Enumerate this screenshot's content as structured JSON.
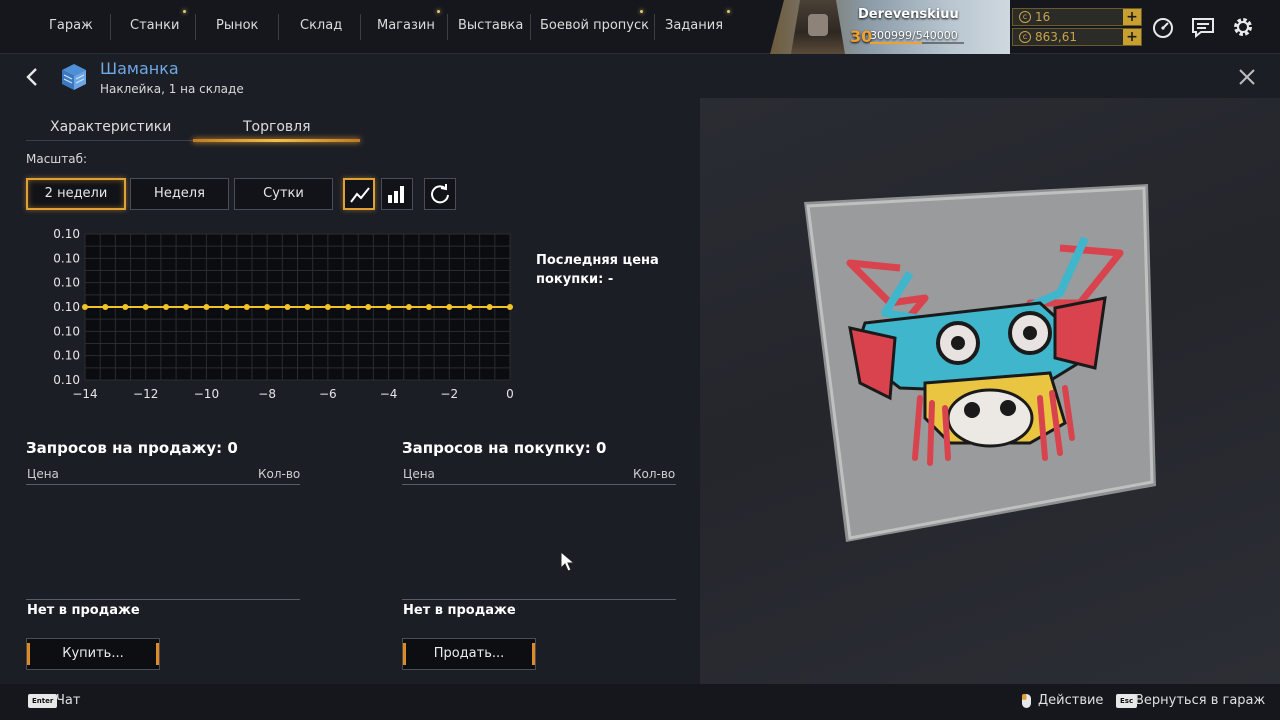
{
  "nav": {
    "items": [
      "Гараж",
      "Станки",
      "Рынок",
      "Склад",
      "Магазин",
      "Выставка",
      "Боевой пропуск",
      "Задания"
    ]
  },
  "profile": {
    "name": "Derevenskiuu",
    "level": "30",
    "xp": "300999/540000",
    "xp_fraction": 0.557
  },
  "currency": {
    "coins": "16",
    "credits": "863,61"
  },
  "item": {
    "title": "Шаманка",
    "subtitle": "Наклейка, 1 на складе"
  },
  "tabs": {
    "characteristics": "Характеристики",
    "trade": "Торговля"
  },
  "scale": {
    "label": "Масштаб:",
    "two_weeks": "2 недели",
    "week": "Неделя",
    "day": "Сутки"
  },
  "chart_data": {
    "type": "line",
    "x": [
      -14,
      -13.33,
      -12.67,
      -12,
      -11.33,
      -10.67,
      -10,
      -9.33,
      -8.67,
      -8,
      -7.33,
      -6.67,
      -6,
      -5.33,
      -4.67,
      -4,
      -3.33,
      -2.67,
      -2,
      -1.33,
      -0.67,
      0
    ],
    "values": [
      0.1,
      0.1,
      0.1,
      0.1,
      0.1,
      0.1,
      0.1,
      0.1,
      0.1,
      0.1,
      0.1,
      0.1,
      0.1,
      0.1,
      0.1,
      0.1,
      0.1,
      0.1,
      0.1,
      0.1,
      0.1,
      0.1
    ],
    "x_ticks": [
      -14,
      -12,
      -10,
      -8,
      -6,
      -4,
      -2,
      0
    ],
    "y_tick_labels": [
      "0.10",
      "0.10",
      "0.10",
      "0.10",
      "0.10",
      "0.10",
      "0.10"
    ],
    "xlim": [
      -14,
      0
    ],
    "grid": true,
    "line_color": "#f2c229"
  },
  "last_price": "Последняя цена покупки: -",
  "sell_orders": {
    "title": "Запросов на продажу: 0",
    "col_price": "Цена",
    "col_qty": "Кол-во",
    "empty": "Нет в продаже",
    "button": "Купить..."
  },
  "buy_orders": {
    "title": "Запросов на покупку: 0",
    "col_price": "Цена",
    "col_qty": "Кол-во",
    "empty": "Нет в продаже",
    "button": "Продать..."
  },
  "footer": {
    "chat_key": "Enter",
    "chat": "Чат",
    "action": "Действие",
    "back_key": "Esc",
    "back": "Вернуться в гараж"
  },
  "colors": {
    "accent": "#e0a032",
    "title_blue": "#6fa8e6",
    "gold": "#c9a34a",
    "level": "#f0a030"
  }
}
